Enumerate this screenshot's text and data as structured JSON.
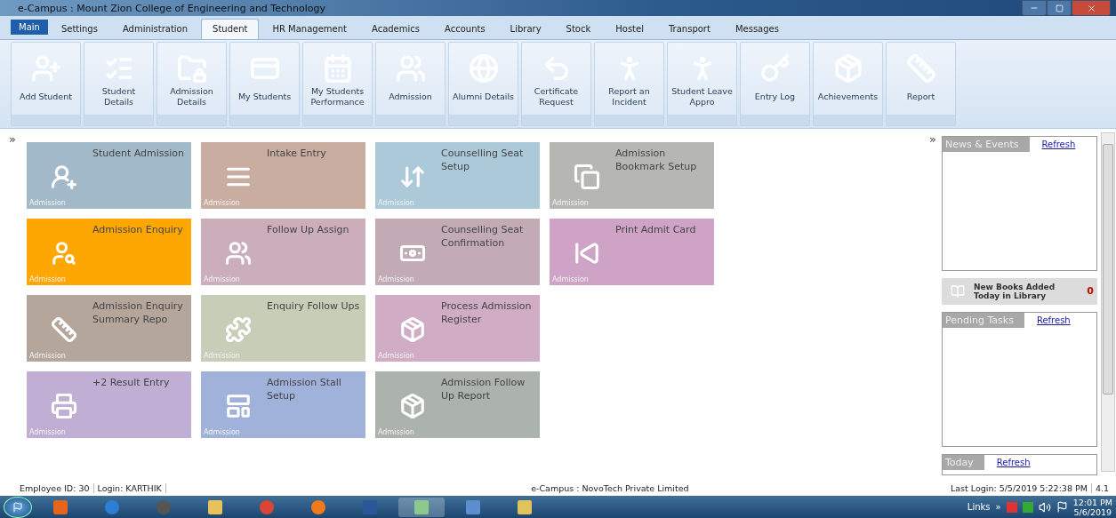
{
  "window": {
    "title": "e-Campus : Mount Zion College of Engineering and Technology"
  },
  "main_button": {
    "label": "Main"
  },
  "tabs": [
    {
      "label": "Settings",
      "selected": false
    },
    {
      "label": "Administration",
      "selected": false
    },
    {
      "label": "Student",
      "selected": true
    },
    {
      "label": "HR Management",
      "selected": false
    },
    {
      "label": "Academics",
      "selected": false
    },
    {
      "label": "Accounts",
      "selected": false
    },
    {
      "label": "Library",
      "selected": false
    },
    {
      "label": "Stock",
      "selected": false
    },
    {
      "label": "Hostel",
      "selected": false
    },
    {
      "label": "Transport",
      "selected": false
    },
    {
      "label": "Messages",
      "selected": false
    }
  ],
  "ribbon": [
    {
      "label": "Add Student"
    },
    {
      "label": "Student Details"
    },
    {
      "label": "Admission Details"
    },
    {
      "label": "My Students"
    },
    {
      "label": "My Students Performance"
    },
    {
      "label": "Admission"
    },
    {
      "label": "Alumni Details"
    },
    {
      "label": "Certificate Request"
    },
    {
      "label": "Report an Incident"
    },
    {
      "label": "Student Leave Appro"
    },
    {
      "label": "Entry Log"
    },
    {
      "label": "Achievements"
    },
    {
      "label": "Report"
    }
  ],
  "expand_left": "»",
  "tile_rows": [
    [
      {
        "title": "Student Admission",
        "category": "Admission",
        "color": "#a2b9c9"
      },
      {
        "title": "Intake Entry",
        "category": "Admission",
        "color": "#c9ada0"
      },
      {
        "title": "Counselling Seat Setup",
        "category": "Admission",
        "color": "#abc9d9"
      },
      {
        "title": "Admission Bookmark Setup",
        "category": "Admission",
        "color": "#b6b7b2"
      }
    ],
    [
      {
        "title": "Admission Enquiry",
        "category": "Admission",
        "color": "#fea601"
      },
      {
        "title": "Follow Up Assign",
        "category": "Admission",
        "color": "#ccaebb"
      },
      {
        "title": "Counselling Seat Confirmation",
        "category": "Admission",
        "color": "#c2abb4"
      },
      {
        "title": "Print Admit Card",
        "category": "Admission",
        "color": "#cfa3c5"
      }
    ],
    [
      {
        "title": "Admission Enquiry Summary Repo",
        "category": "Admission",
        "color": "#b5a69c"
      },
      {
        "title": "Enquiry Follow Ups",
        "category": "Admission",
        "color": "#c8cdb8"
      },
      {
        "title": "Process Admission Register",
        "category": "Admission",
        "color": "#d1adc5"
      }
    ],
    [
      {
        "title": "+2 Result Entry",
        "category": "Admission",
        "color": "#c0aed4"
      },
      {
        "title": "Admission Stall Setup",
        "category": "Admission",
        "color": "#a0b1da"
      },
      {
        "title": "Admission Follow Up Report",
        "category": "Admission",
        "color": "#acb3ad"
      }
    ]
  ],
  "side_panel": {
    "expand": "»",
    "news": {
      "title": "News & Events",
      "link": "Refresh"
    },
    "books": {
      "label": "New Books Added Today in Library",
      "count": "0"
    },
    "pending": {
      "title": "Pending Tasks",
      "link": "Refresh"
    },
    "today": {
      "title": "Today",
      "link": "Refresh"
    }
  },
  "status_bar": {
    "employee": "Employee ID: 30",
    "login": "Login: KARTHIK",
    "company": "e-Campus : NovoTech Private Limited",
    "last_login": "Last Login: 5/5/2019 5:22:38 PM",
    "version": "4.1"
  },
  "taskbar": {
    "links": "Links",
    "chevron": "»",
    "time": "12:01 PM",
    "date": "5/6/2019"
  }
}
